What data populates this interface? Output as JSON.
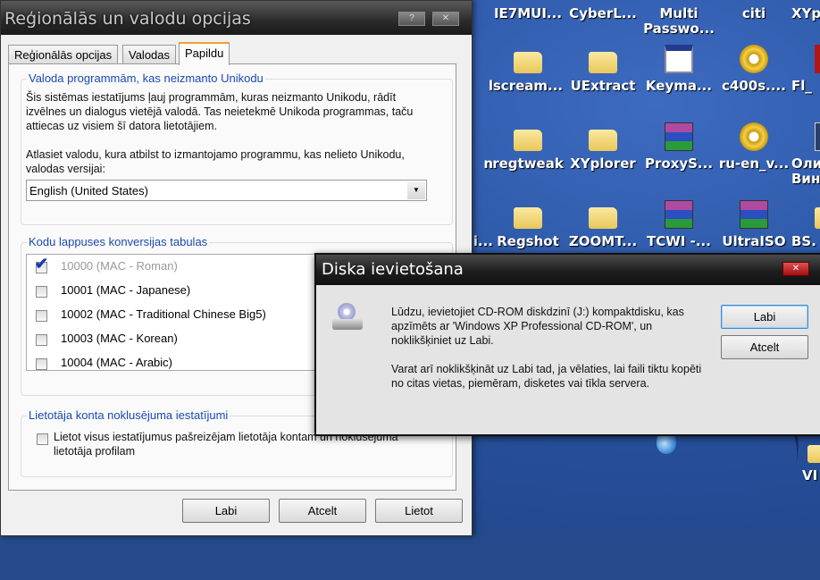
{
  "desktop": {
    "icons": [
      {
        "label": "IE7MUI..."
      },
      {
        "label": "CyberL..."
      },
      {
        "label": "Multi Passwo..."
      },
      {
        "label": "citi"
      },
      {
        "label": "XYp"
      },
      {
        "label": "l"
      },
      {
        "label": "scream..."
      },
      {
        "label": "UExtract"
      },
      {
        "label": "Keyma..."
      },
      {
        "label": "c400s...."
      },
      {
        "label": "Fl_"
      },
      {
        "label": "n"
      },
      {
        "label": "regtweak"
      },
      {
        "label": "XYplorer"
      },
      {
        "label": "ProxyS..."
      },
      {
        "label": "ru-en_v..."
      },
      {
        "label": "Оли Вин"
      },
      {
        "label": "i..."
      },
      {
        "label": "Regshot"
      },
      {
        "label": "ZOOMT..."
      },
      {
        "label": "TCWI -..."
      },
      {
        "label": "UltraISO"
      },
      {
        "label": "BS."
      },
      {
        "label": "VI"
      }
    ]
  },
  "regional": {
    "title": "Reģionālās un valodu opcijas",
    "help": "?",
    "close": "✕",
    "tabs": [
      "Reģionālās opcijas",
      "Valodas",
      "Papildu"
    ],
    "group1": {
      "label": "Valoda programmām, kas neizmanto Unikodu",
      "desc": "Šis sistēmas iestatījums ļauj programmām, kuras neizmanto Unikodu, rādīt izvēlnes un dialogus vietējā valodā. Tas neietekmē Unikoda programmas, taču attiecas uz visiem šī datora lietotājiem.",
      "prompt": "Atlasiet valodu, kura atbilst to izmantojamo programmu, kas nelieto Unikodu, valodas versijai:",
      "selected": "English (United States)"
    },
    "group2": {
      "label": "Kodu lappuses konversijas tabulas",
      "items": [
        {
          "text": "10000 (MAC - Roman)",
          "checked": true,
          "disabled": true
        },
        {
          "text": "10001 (MAC - Japanese)",
          "checked": false
        },
        {
          "text": "10002 (MAC - Traditional Chinese Big5)",
          "checked": false
        },
        {
          "text": "10003 (MAC - Korean)",
          "checked": false
        },
        {
          "text": "10004 (MAC - Arabic)",
          "checked": false
        }
      ]
    },
    "group3": {
      "label": "Lietotāja konta noklusējuma iestatījumi",
      "checkbox": "Lietot visus iestatījumus pašreizējam lietotāja kontam un noklusējuma lietotāja profilam"
    },
    "buttons": {
      "ok": "Labi",
      "cancel": "Atcelt",
      "apply": "Lietot"
    }
  },
  "modal": {
    "title": "Diska ievietošana",
    "close": "✕",
    "msg1": "Lūdzu, ievietojiet CD-ROM diskdzinī (J:) kompaktdisku, kas apzīmēts ar 'Windows XP Professional CD-ROM', un noklikšķiniet uz Labi.",
    "msg2": "Varat arī noklikšķināt uz Labi tad, ja vēlaties, lai faili tiktu kopēti no citas vietas, piemēram, disketes vai tīkla servera.",
    "ok": "Labi",
    "cancel": "Atcelt"
  }
}
